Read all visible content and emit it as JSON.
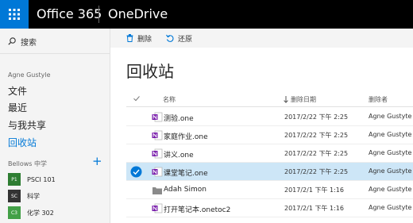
{
  "suite": {
    "title": "Office 365",
    "app": "OneDrive"
  },
  "nav": {
    "search_label": "搜索",
    "user": "Agne Gustyle",
    "items": [
      {
        "label": "文件",
        "active": false
      },
      {
        "label": "最近",
        "active": false
      },
      {
        "label": "与我共享",
        "active": false
      },
      {
        "label": "回收站",
        "active": true
      }
    ],
    "group_header": "Bellows 中学",
    "notebooks": [
      {
        "code": "P1",
        "label": "PSCI 101",
        "color": "#2e7d32"
      },
      {
        "code": "SC",
        "label": "科学",
        "color": "#333333"
      },
      {
        "code": "C3",
        "label": "化学 302",
        "color": "#43a047"
      }
    ]
  },
  "toolbar": {
    "delete_label": "删除",
    "restore_label": "还原"
  },
  "main": {
    "title": "回收站",
    "columns": {
      "name": "名称",
      "deleted_date": "删除日期",
      "deleted_by": "删除者"
    },
    "rows": [
      {
        "name": "测验.one",
        "date": "2017/2/22 下午 2:25",
        "by": "Agne Gustyte",
        "type": "onenote",
        "selected": false
      },
      {
        "name": "家庭作业.one",
        "date": "2017/2/22 下午 2:25",
        "by": "Agne Gustyte",
        "type": "onenote",
        "selected": false
      },
      {
        "name": "讲义.one",
        "date": "2017/2/22 下午 2:25",
        "by": "Agne Gustyte",
        "type": "onenote",
        "selected": false
      },
      {
        "name": "课堂笔记.one",
        "date": "2017/2/22 下午 2:25",
        "by": "Agne Gustyte",
        "type": "onenote",
        "selected": true
      },
      {
        "name": "Adah Simon",
        "date": "2017/2/1 下午 1:16",
        "by": "Agne Gustyte",
        "type": "folder",
        "selected": false
      },
      {
        "name": "打开笔记本.onetoc2",
        "date": "2017/2/1 下午 1:16",
        "by": "Agne Gustyte",
        "type": "onenote",
        "selected": false
      }
    ]
  },
  "colors": {
    "accent": "#0078d7",
    "onenote": "#7719aa",
    "folder": "#8a8a8a",
    "selected_row": "#cde6f7"
  }
}
